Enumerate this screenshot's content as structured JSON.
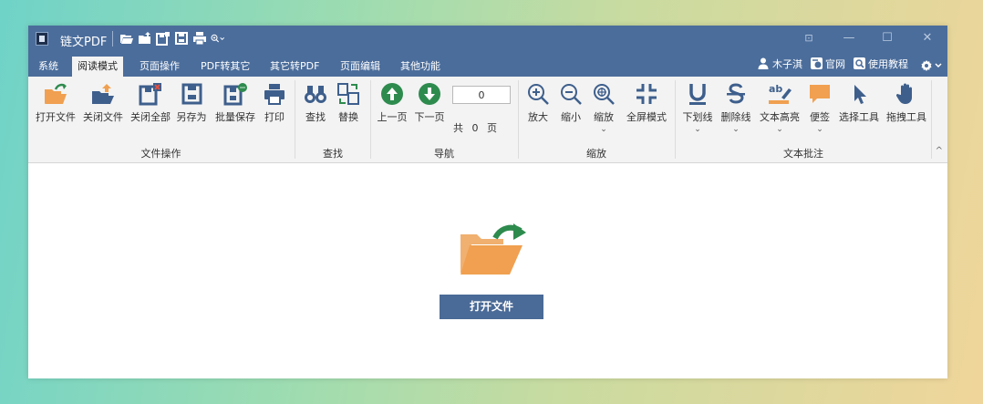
{
  "app": {
    "title": "链文PDF"
  },
  "window_controls": {
    "restore": "⊡",
    "minimize": "—",
    "maximize": "☐",
    "close": "✕"
  },
  "menu": {
    "tabs": [
      "系统",
      "阅读模式",
      "页面操作",
      "PDF转其它",
      "其它转PDF",
      "页面编辑",
      "其他功能"
    ],
    "active": "阅读模式",
    "user": "木子淇",
    "website": "官网",
    "tutorial": "使用教程"
  },
  "ribbon": {
    "groups": {
      "file": {
        "label": "文件操作",
        "buttons": [
          "打开文件",
          "关闭文件",
          "关闭全部",
          "另存为",
          "批量保存",
          "打印"
        ]
      },
      "find": {
        "label": "查找",
        "buttons": [
          "查找",
          "替换"
        ]
      },
      "nav": {
        "label": "导航",
        "prev": "上一页",
        "next": "下一页",
        "page_value": "0",
        "total": "共 0 页"
      },
      "zoom": {
        "label": "缩放",
        "buttons": [
          "放大",
          "缩小",
          "缩放",
          "全屏模式"
        ]
      },
      "annot": {
        "label": "文本批注",
        "buttons": [
          "下划线",
          "删除线",
          "文本高亮",
          "便签",
          "选择工具",
          "拖拽工具"
        ]
      }
    },
    "collapse": "^"
  },
  "content": {
    "open_label": "打开文件"
  },
  "colors": {
    "titlebar": "#4b6d9b",
    "accent_green": "#2e8b4e",
    "folder_orange": "#f0a050",
    "open_button": "#4a6a97"
  }
}
